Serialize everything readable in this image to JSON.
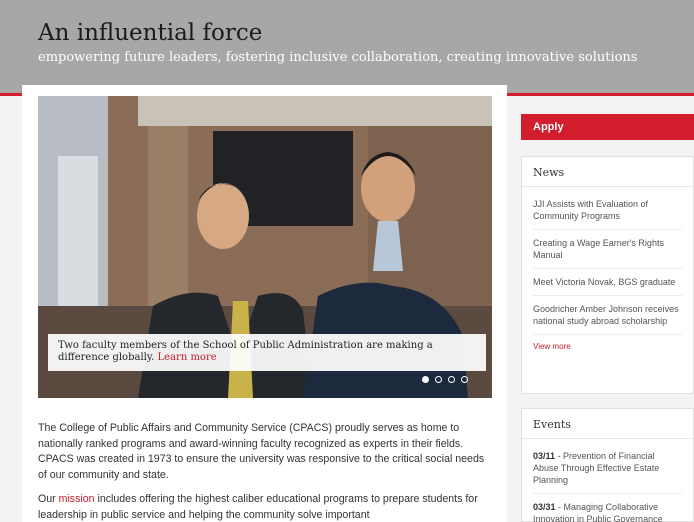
{
  "banner": {
    "title": "An influential force",
    "subtitle": "empowering future leaders, fostering inclusive collaboration, creating innovative solutions"
  },
  "hero": {
    "caption": "Two faculty members of the School of Public Administration are making a difference globally.",
    "link": "Learn more",
    "slides": 4,
    "active_slide": 1
  },
  "content": {
    "p1": "The College of Public Affairs and Community Service (CPACS) proudly serves as home to nationally ranked programs and award-winning faculty recognized as experts in their fields. CPACS was created in 1973 to ensure the university was responsive to the critical social needs of our community and state.",
    "p2_before": "Our",
    "p2_link": "mission",
    "p2_after": "includes offering the highest caliber educational programs to prepare students for leadership in public service and helping the community solve important"
  },
  "sidebar": {
    "apply_label": "Apply",
    "news_title": "News",
    "news_items": [
      "JJI Assists with Evaluation of Community Programs",
      "Creating a Wage Earner's Rights Manual",
      "Meet Victoria Novak, BGS graduate",
      "Goodricher Amber Johnson receives national study abroad scholarship"
    ],
    "view_more": "View more",
    "events_title": "Events",
    "events": [
      {
        "date": "03/11",
        "text": " - Prevention of Financial Abuse Through Effective Estate Planning"
      },
      {
        "date": "03/31",
        "text": " - Managing Collaborative Innovation in Public Governance"
      }
    ]
  },
  "colors": {
    "accent": "#d11d2c",
    "banner": "#a7a7a7"
  }
}
